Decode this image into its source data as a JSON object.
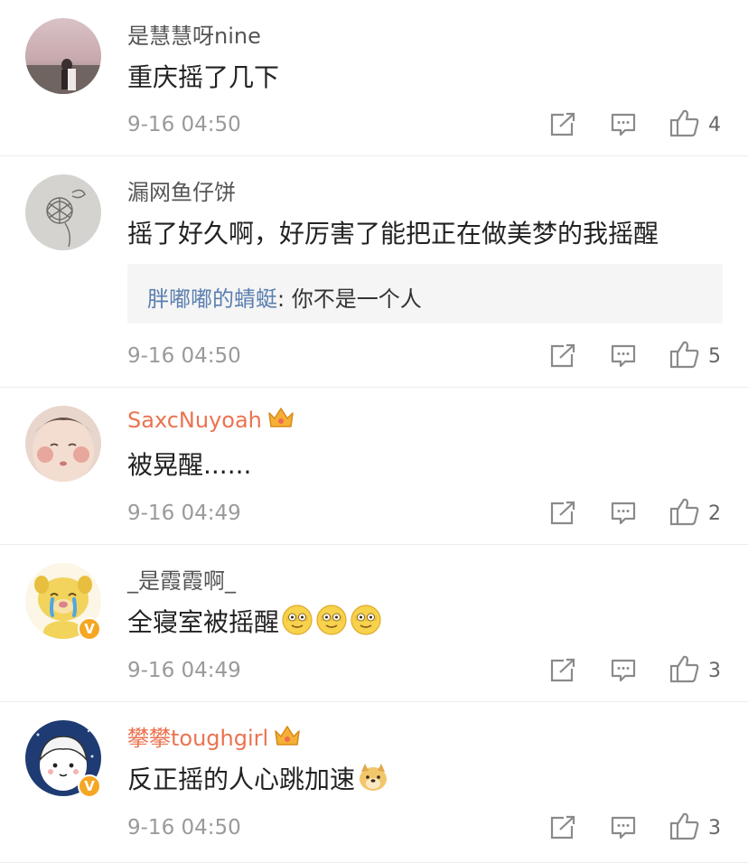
{
  "comments": [
    {
      "username": "是慧慧呀nine",
      "text": "重庆摇了几下",
      "time": "9-16 04:50",
      "likes": "4",
      "avatar_icon": "couple-photo-avatar"
    },
    {
      "username": "漏网鱼仔饼",
      "text": "摇了好久啊，好厉害了能把正在做美梦的我摇醒",
      "reply_user": "胖嘟嘟的蜻蜓",
      "reply_text": ": 你不是一个人",
      "time": "9-16 04:50",
      "likes": "5",
      "avatar_icon": "flower-sketch-avatar"
    },
    {
      "username": "SaxcNuyoah",
      "text": "被晃醒......",
      "time": "9-16 04:49",
      "likes": "2",
      "vip": true,
      "avatar_icon": "baby-face-avatar"
    },
    {
      "username": "_是霞霞啊_",
      "text": "全寝室被摇醒",
      "time": "9-16 04:49",
      "likes": "3",
      "verified": "V",
      "avatar_icon": "crying-dog-avatar"
    },
    {
      "username": "攀攀toughgirl",
      "text": "反正摇的人心跳加速",
      "time": "9-16 04:50",
      "likes": "3",
      "vip": true,
      "verified": "V",
      "avatar_icon": "cartoon-girl-avatar"
    }
  ],
  "colors": {
    "vip_name": "#eb7350",
    "reply_name": "#5b7fb0",
    "meta": "#9a9a9a",
    "badge": "#f5a623"
  }
}
